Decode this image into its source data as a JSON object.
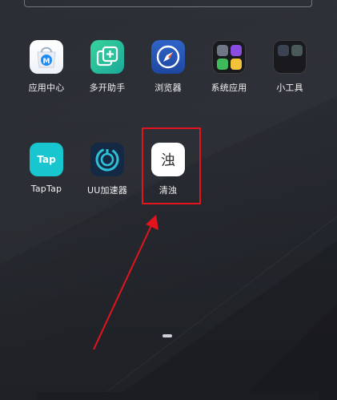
{
  "apps_row1": [
    {
      "label": "应用中心",
      "icon": "app-store-icon"
    },
    {
      "label": "多开助手",
      "icon": "multi-open-icon"
    },
    {
      "label": "浏览器",
      "icon": "compass-icon"
    },
    {
      "label": "系统应用",
      "icon": "folder-icon"
    },
    {
      "label": "小工具",
      "icon": "folder-icon"
    }
  ],
  "apps_row2": [
    {
      "label": "TapTap",
      "icon": "taptap-icon",
      "icon_text": "Tap"
    },
    {
      "label": "UU加速器",
      "icon": "uu-accelerator-icon"
    },
    {
      "label": "清浊",
      "icon": "qingzhuo-icon",
      "icon_text": "浊"
    }
  ],
  "app_store_badge": "M",
  "colors": {
    "highlight": "#e3141b",
    "wallpaper": "#25272d",
    "taptap": "#17c6cf",
    "multi_open": "#2cc19a",
    "browser": "#2656b8"
  }
}
